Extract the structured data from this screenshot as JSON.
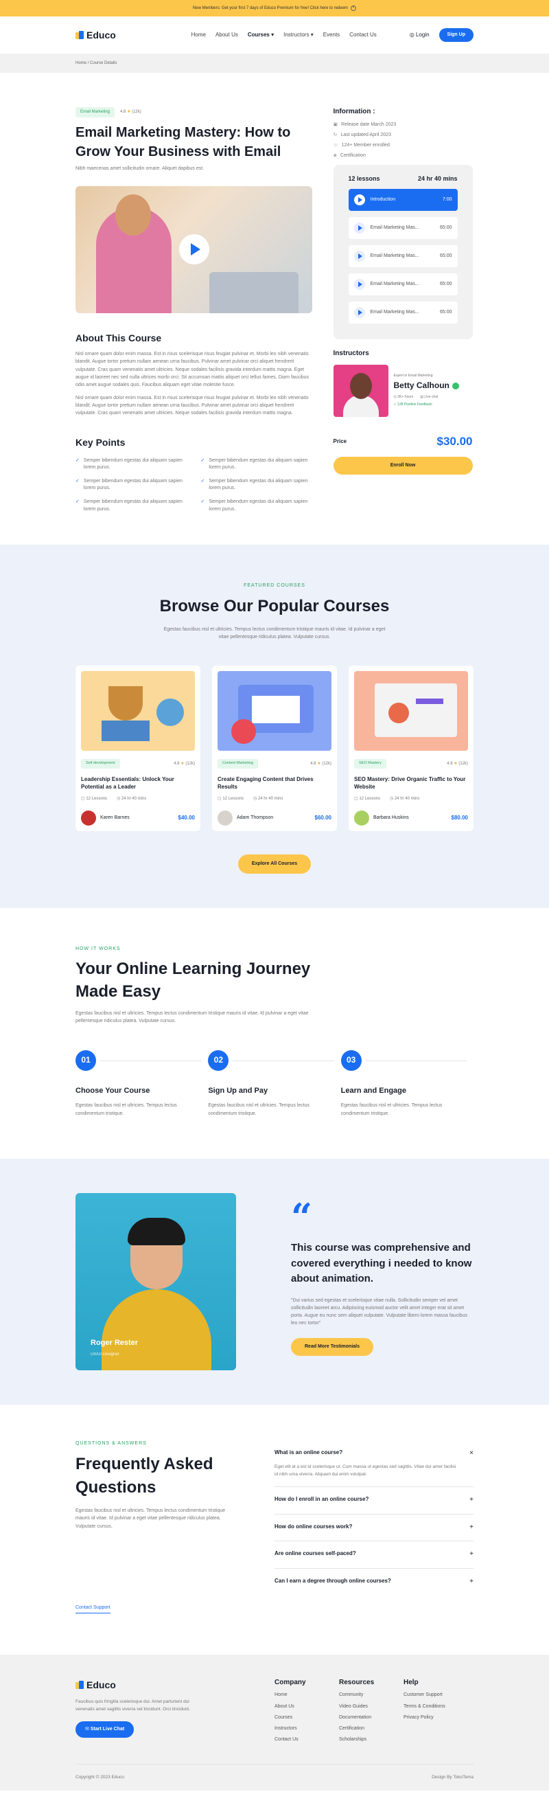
{
  "topbar": {
    "text": "New Members: Get your first 7 days of Educo Premium for free! Click here to redeem"
  },
  "brand": {
    "name": "Educo"
  },
  "nav": {
    "items": [
      "Home",
      "About Us",
      "Courses",
      "Instructors",
      "Events",
      "Contact Us"
    ],
    "login": "Login",
    "signup": "Sign Up"
  },
  "breadcrumb": {
    "home": "Home",
    "current": "Course Details"
  },
  "course": {
    "tag": "Email Marketing",
    "rating": "4.8",
    "reviews": "(12k)",
    "title": "Email Marketing Mastery: How to Grow Your Business with Email",
    "subtitle": "Nibh maecenas amet sollicitudin ornare. Aliquet dapibus est.",
    "about_title": "About This Course",
    "about_p1": "Nisl ornare quam dolor enim massa. Est in risus scelerisque risus feugiat pulvinar et. Morbi leo nibh venenatis blandit. Augue tortor pretium nullam aenean urna faucibus. Pulvinar amet pulvinar orci aliquet hendrerit vulputate. Cras quam venenatis amet ultricies. Neque sodales facilisis gravida interdum mattis magna. Eget augue id laoreet nec sed nulla ultrices morbi orci. Sit accumsan mattis aliquet orci tellus fames. Diam faucibus odio amet augue sodales quis. Faucibus aliquam eget vitae molestie fusce.",
    "about_p2": "Nisl ornare quam dolor enim massa. Est in risus scelerisque risus feugiat pulvinar et. Morbi leo nibh venenatis blandit. Augue tortor pretium nullam aenean urna faucibus. Pulvinar amet pulvinar orci aliquet hendrerit vulputate. Cras quam venenatis amet ultricies. Neque sodales facilisis gravida interdum mattis magna.",
    "keypoints_title": "Key Points",
    "keypoints": [
      "Semper bibendum egestas dui aliquam sapien lorem purus.",
      "Semper bibendum egestas dui aliquam sapien lorem purus.",
      "Semper bibendum egestas dui aliquam sapien lorem purus.",
      "Semper bibendum egestas dui aliquam sapien lorem purus.",
      "Semper bibendum egestas dui aliquam sapien lorem purus.",
      "Semper bibendum egestas dui aliquam sapien lorem purus."
    ]
  },
  "info": {
    "title": "Information :",
    "items": [
      "Release date March 2023",
      "Last updated April 2023",
      "124+ Member enrolled",
      "Certification"
    ]
  },
  "lessons": {
    "count": "12 lessons",
    "duration": "24 hr 40 mins",
    "items": [
      {
        "title": "Introduction",
        "time": "7:00"
      },
      {
        "title": "Email Marketing Mas...",
        "time": "65:00"
      },
      {
        "title": "Email Marketing Mas...",
        "time": "65:00"
      },
      {
        "title": "Email Marketing Mas...",
        "time": "65:00"
      },
      {
        "title": "Email Marketing Mas...",
        "time": "65:00"
      }
    ]
  },
  "instructor": {
    "title": "Instructors",
    "expert": "Expert in Email Marketing",
    "name": "Betty Calhoun",
    "hours": "2K+ hours",
    "chat": "Live chat",
    "feedback": "128 Positive Feedback"
  },
  "pricebox": {
    "label": "Price",
    "value": "$30.00",
    "cta": "Enroll Now"
  },
  "popular": {
    "eyebrow": "FEATURED COURSES",
    "title": "Browse Our Popular Courses",
    "desc": "Egestas faucibus nisl et ultricies. Tempus lectus condimentum tristique mauris id vitae. Id pulvinar a eget vitae pellentesque ridiculus platea. Vulputate cursus.",
    "cta": "Explore All Courses",
    "cards": [
      {
        "tag": "Self development",
        "rating": "4.8",
        "reviews": "(12k)",
        "title": "Leadership Essentials: Unlock Your Potential as a Leader",
        "lessons": "12 Lessons",
        "duration": "24 hr 40 mins",
        "author": "Karen Barnes",
        "price": "$40.00"
      },
      {
        "tag": "Content Marketing",
        "rating": "4.8",
        "reviews": "(12k)",
        "title": "Create Engaging Content that Drives Results",
        "lessons": "12 Lessons",
        "duration": "24 hr 40 mins",
        "author": "Adam Thompson",
        "price": "$60.00"
      },
      {
        "tag": "SEO Mastery",
        "rating": "4.8",
        "reviews": "(12k)",
        "title": "SEO Mastery: Drive Organic Traffic to Your Website",
        "lessons": "12 Lessons",
        "duration": "24 hr 40 mins",
        "author": "Barbara Huskins",
        "price": "$80.00"
      }
    ]
  },
  "how": {
    "eyebrow": "HOW IT WORKS",
    "title": "Your Online Learning Journey Made Easy",
    "desc": "Egestas faucibus nisl et ultricies. Tempus lectus condimentum tristique mauris id vitae. Id pulvinar a eget vitae pellentesque ridiculus platea. Vulputate cursus.",
    "steps": [
      {
        "num": "01",
        "title": "Choose Your Course",
        "desc": "Egestas faucibus nisl et ultricies. Tempus lectus condimentum tristique."
      },
      {
        "num": "02",
        "title": "Sign Up and Pay",
        "desc": "Egestas faucibus nisl et ultricies. Tempus lectus condimentum tristique."
      },
      {
        "num": "03",
        "title": "Learn and Engage",
        "desc": "Egestas faucibus nisl et ultricies. Tempus lectus condimentum tristique."
      }
    ]
  },
  "testimonial": {
    "name": "Roger Rester",
    "role": "UX/UI Designer",
    "quote": "This course was comprehensive and covered everything i needed to know about animation.",
    "text": "\"Dui varius sed egestas et scelerisque vitae nulla. Sollicitudin semper vel amet sollicitudin laoreet arcu. Adipiscing euismod auctor velit amet integer erat sit amet porta. Augue eu nunc sem aliquet vulputate. Vulputate libero lorem massa faucibus leo nec tortor\"",
    "cta": "Read More Testimonials"
  },
  "faq": {
    "eyebrow": "QUESTIONS & ANSWERS",
    "title": "Frequently Asked Questions",
    "desc": "Egestas faucibus nisl et ultricies. Tempus lectus condimentum tristique mauris id vitae. Id pulvinar a eget vitae pellentesque ridiculus platea. Vulputate cursus.",
    "contact": "Contact Support",
    "items": [
      {
        "q": "What is an online course?",
        "a": "Eget elit at a est id scelerisque ut. Cum massa ut egestas sed sagittis. Vitae dui amet facilisi id nibh urna viverra. Aliquam dui enim volutpat.",
        "open": true,
        "sym": "×"
      },
      {
        "q": "How do I enroll in an online course?",
        "sym": "+"
      },
      {
        "q": "How do online courses work?",
        "sym": "+"
      },
      {
        "q": "Are online courses self-paced?",
        "sym": "+"
      },
      {
        "q": "Can I earn a degree through online courses?",
        "sym": "+"
      }
    ]
  },
  "footer": {
    "desc": "Faucibus quis fringilla scelerisque dui. Amet parturient dui venenatis amet sagittis viverra vel tincidunt. Orci tincidunt.",
    "chat": "Start Live Chat",
    "cols": [
      {
        "title": "Company",
        "links": [
          "Home",
          "About Us",
          "Courses",
          "Instructors",
          "Contact Us"
        ]
      },
      {
        "title": "Resources",
        "links": [
          "Community",
          "Video Guides",
          "Documentation",
          "Certification",
          "Scholarships"
        ]
      },
      {
        "title": "Help",
        "links": [
          "Customer Support",
          "Terms & Conditions",
          "Privacy Policy"
        ]
      }
    ],
    "copyright": "Copyright © 2023 Educo",
    "design": "Design By TokoTema"
  },
  "colors": {
    "primary": "#1a6df0",
    "accent": "#fcc64a",
    "success": "#28a163"
  }
}
